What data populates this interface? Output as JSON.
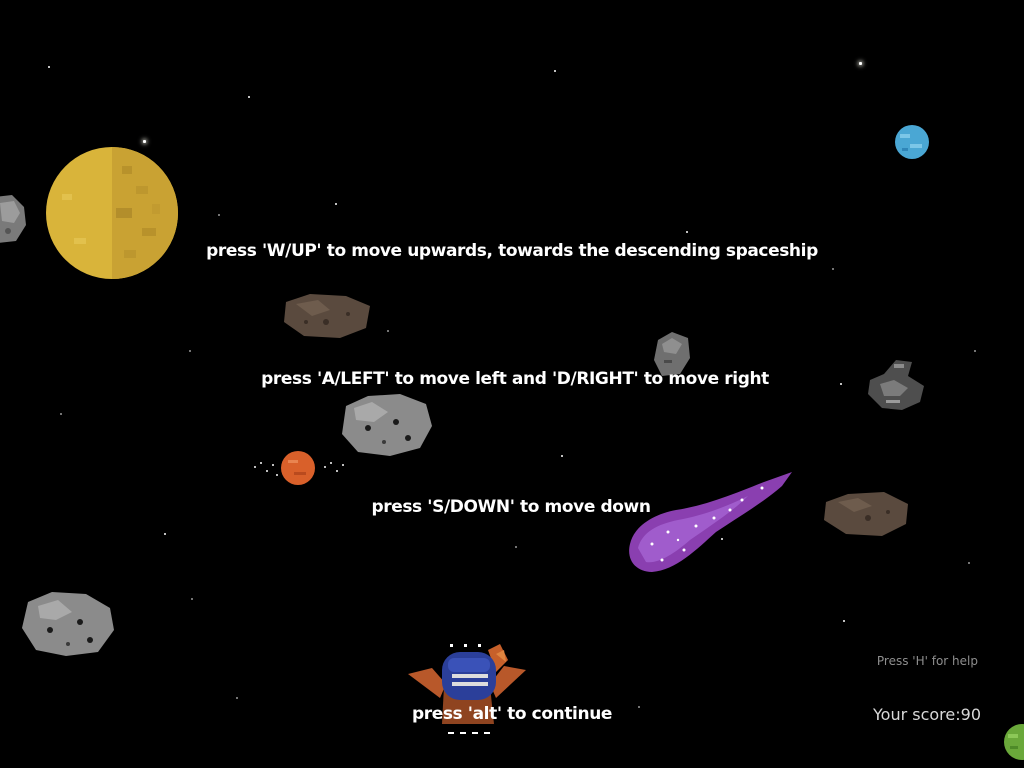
{
  "instructions": {
    "move_up": "press 'W/UP' to move upwards, towards the descending spaceship",
    "move_sideways": "press 'A/LEFT' to move left and 'D/RIGHT' to move right",
    "move_down": "press 'S/DOWN' to move down",
    "continue": "press 'alt' to continue"
  },
  "hud": {
    "help_hint": "Press 'H' for help",
    "score_label": "Your score:",
    "score_value": "90"
  },
  "colors": {
    "background": "#000000",
    "yellow_planet": "#d9b43a",
    "blue_planet": "#4aa7d4",
    "orange_planet": "#d9602a",
    "green_planet": "#6aa83a",
    "asteroid": "#8b8b8b",
    "brown_rock": "#5a4a3e",
    "comet": "#8a3fb0",
    "ship_blue": "#2b3f9a",
    "ship_orange": "#c7602a"
  },
  "sprites": [
    "yellow-planet-icon",
    "blue-planet-icon",
    "orange-planet-icon",
    "green-planet-icon",
    "asteroid-icon",
    "brown-rock-icon",
    "purple-comet-icon",
    "spaceship-wreck-icon",
    "player-spaceship-icon"
  ]
}
